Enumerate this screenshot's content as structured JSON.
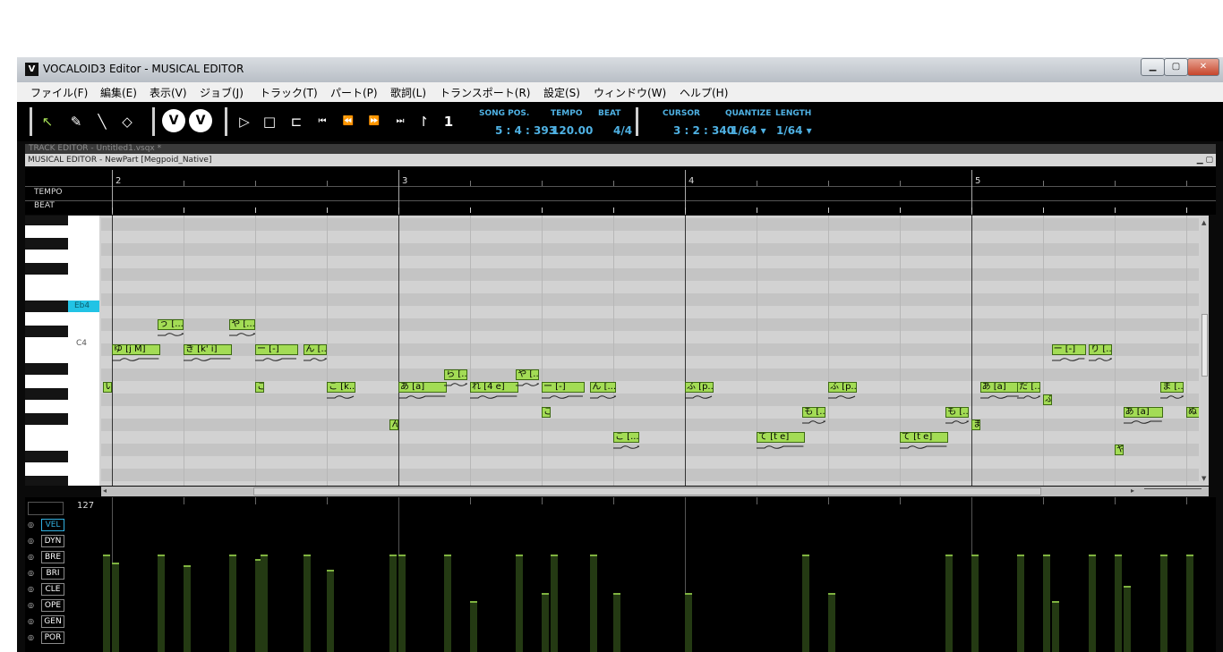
{
  "window": {
    "title": "VOCALOID3 Editor - MUSICAL EDITOR",
    "app_icon": "V"
  },
  "menu": [
    "ファイル(F)",
    "編集(E)",
    "表示(V)",
    "ジョブ(J)",
    "トラック(T)",
    "パート(P)",
    "歌詞(L)",
    "トランスポート(R)",
    "設定(S)",
    "ウィンドウ(W)",
    "ヘルプ(H)"
  ],
  "toolbar": {
    "tools": [
      "arrow-tool-icon",
      "pencil-tool-icon",
      "line-tool-icon",
      "eraser-tool-icon"
    ],
    "transport": [
      "play-icon",
      "stop-icon",
      "loop-icon",
      "go-start-icon",
      "rewind-icon",
      "fast-forward-icon",
      "go-end-icon",
      "start-marker-icon",
      "end-marker-icon"
    ],
    "song_pos_label": "SONG POS.",
    "song_pos": "5 : 4 : 393",
    "tempo_label": "TEMPO",
    "tempo": "120.00",
    "beat_label": "BEAT",
    "beat": "4/4",
    "cursor_label": "CURSOR",
    "cursor": "3 : 2 : 340",
    "quantize_label": "QUANTIZE",
    "quantize": "1/64 ▾",
    "length_label": "LENGTH",
    "length": "1/64 ▾"
  },
  "track_editor_title": "TRACK EDITOR - Untitled1.vsqx *",
  "musical_editor_title": "MUSICAL EDITOR - NewPart [Megpoid_Native]",
  "ruler": {
    "tempo_label": "TEMPO",
    "beat_label": "BEAT",
    "bars": [
      "2",
      "3",
      "4",
      "5"
    ]
  },
  "keys": {
    "highlight": "Eb4",
    "c4": "C4"
  },
  "notes": [
    {
      "lyric": "う [...",
      "t": 0.16,
      "row": 8,
      "len": 0.09
    },
    {
      "lyric": "や [...",
      "t": 0.41,
      "row": 8,
      "len": 0.09
    },
    {
      "lyric": "ゆ [j M]",
      "t": 0.0,
      "row": 10,
      "len": 0.17
    },
    {
      "lyric": "き [k' i]",
      "t": 0.25,
      "row": 10,
      "len": 0.17
    },
    {
      "lyric": "ー [-]",
      "t": 0.5,
      "row": 10,
      "len": 0.15
    },
    {
      "lyric": "ん [...",
      "t": 0.67,
      "row": 10,
      "len": 0.08
    },
    {
      "lyric": "い",
      "t": -0.03,
      "row": 13,
      "len": 0.03
    },
    {
      "lyric": "こ",
      "t": 0.5,
      "row": 13,
      "len": 0.03
    },
    {
      "lyric": "こ [k...",
      "t": 0.75,
      "row": 13,
      "len": 0.1
    },
    {
      "lyric": "あ [a]",
      "t": 1.0,
      "row": 13,
      "len": 0.17
    },
    {
      "lyric": "ら [...",
      "t": 1.16,
      "row": 12,
      "len": 0.08
    },
    {
      "lyric": "れ [4 e]",
      "t": 1.25,
      "row": 13,
      "len": 0.17
    },
    {
      "lyric": "や [...",
      "t": 1.41,
      "row": 12,
      "len": 0.08
    },
    {
      "lyric": "ー [-]",
      "t": 1.5,
      "row": 13,
      "len": 0.15
    },
    {
      "lyric": "ん [...",
      "t": 1.67,
      "row": 13,
      "len": 0.09
    },
    {
      "lyric": "こ",
      "t": 1.5,
      "row": 15,
      "len": 0.03
    },
    {
      "lyric": "ん",
      "t": 0.97,
      "row": 16,
      "len": 0.03
    },
    {
      "lyric": "こ [...",
      "t": 1.75,
      "row": 17,
      "len": 0.09
    },
    {
      "lyric": "ふ [p...",
      "t": 2.0,
      "row": 13,
      "len": 0.1
    },
    {
      "lyric": "て [t e]",
      "t": 2.25,
      "row": 17,
      "len": 0.17
    },
    {
      "lyric": "も [...",
      "t": 2.41,
      "row": 15,
      "len": 0.08
    },
    {
      "lyric": "ふ [p...",
      "t": 2.5,
      "row": 13,
      "len": 0.1
    },
    {
      "lyric": "て [t e]",
      "t": 2.75,
      "row": 17,
      "len": 0.17
    },
    {
      "lyric": "も [...",
      "t": 2.91,
      "row": 15,
      "len": 0.08
    },
    {
      "lyric": "ま",
      "t": 3.0,
      "row": 16,
      "len": 0.03
    },
    {
      "lyric": "あ [a]",
      "t": 3.03,
      "row": 13,
      "len": 0.14
    },
    {
      "lyric": "だ [...",
      "t": 3.16,
      "row": 13,
      "len": 0.08
    },
    {
      "lyric": "ふ",
      "t": 3.25,
      "row": 14,
      "len": 0.03
    },
    {
      "lyric": "ー [-]",
      "t": 3.28,
      "row": 10,
      "len": 0.12
    },
    {
      "lyric": "り [...",
      "t": 3.41,
      "row": 10,
      "len": 0.08
    },
    {
      "lyric": "や",
      "t": 3.5,
      "row": 18,
      "len": 0.03
    },
    {
      "lyric": "あ [a]",
      "t": 3.53,
      "row": 15,
      "len": 0.14
    },
    {
      "lyric": "ま [...",
      "t": 3.66,
      "row": 13,
      "len": 0.08
    },
    {
      "lyric": "ぬ",
      "t": 3.75,
      "row": 15,
      "len": 0.05
    }
  ],
  "control": {
    "max_label": "127",
    "params": [
      "VEL",
      "DYN",
      "BRE",
      "BRI",
      "CLE",
      "OPE",
      "GEN",
      "POR"
    ],
    "active": "VEL"
  },
  "velocity": [
    {
      "t": -0.03,
      "v": 0.63
    },
    {
      "t": 0.0,
      "v": 0.58
    },
    {
      "t": 0.16,
      "v": 0.63
    },
    {
      "t": 0.25,
      "v": 0.56
    },
    {
      "t": 0.41,
      "v": 0.63
    },
    {
      "t": 0.5,
      "v": 0.6
    },
    {
      "t": 0.52,
      "v": 0.63
    },
    {
      "t": 0.67,
      "v": 0.63
    },
    {
      "t": 0.75,
      "v": 0.53
    },
    {
      "t": 0.97,
      "v": 0.63
    },
    {
      "t": 1.0,
      "v": 0.63
    },
    {
      "t": 1.16,
      "v": 0.63
    },
    {
      "t": 1.25,
      "v": 0.33
    },
    {
      "t": 1.41,
      "v": 0.63
    },
    {
      "t": 1.5,
      "v": 0.38
    },
    {
      "t": 1.53,
      "v": 0.63
    },
    {
      "t": 1.67,
      "v": 0.63
    },
    {
      "t": 1.75,
      "v": 0.38
    },
    {
      "t": 2.0,
      "v": 0.38
    },
    {
      "t": 2.41,
      "v": 0.63
    },
    {
      "t": 2.5,
      "v": 0.38
    },
    {
      "t": 2.91,
      "v": 0.63
    },
    {
      "t": 3.0,
      "v": 0.63
    },
    {
      "t": 3.16,
      "v": 0.63
    },
    {
      "t": 3.25,
      "v": 0.63
    },
    {
      "t": 3.28,
      "v": 0.33
    },
    {
      "t": 3.41,
      "v": 0.63
    },
    {
      "t": 3.5,
      "v": 0.63
    },
    {
      "t": 3.53,
      "v": 0.43
    },
    {
      "t": 3.66,
      "v": 0.63
    },
    {
      "t": 3.75,
      "v": 0.63
    }
  ]
}
